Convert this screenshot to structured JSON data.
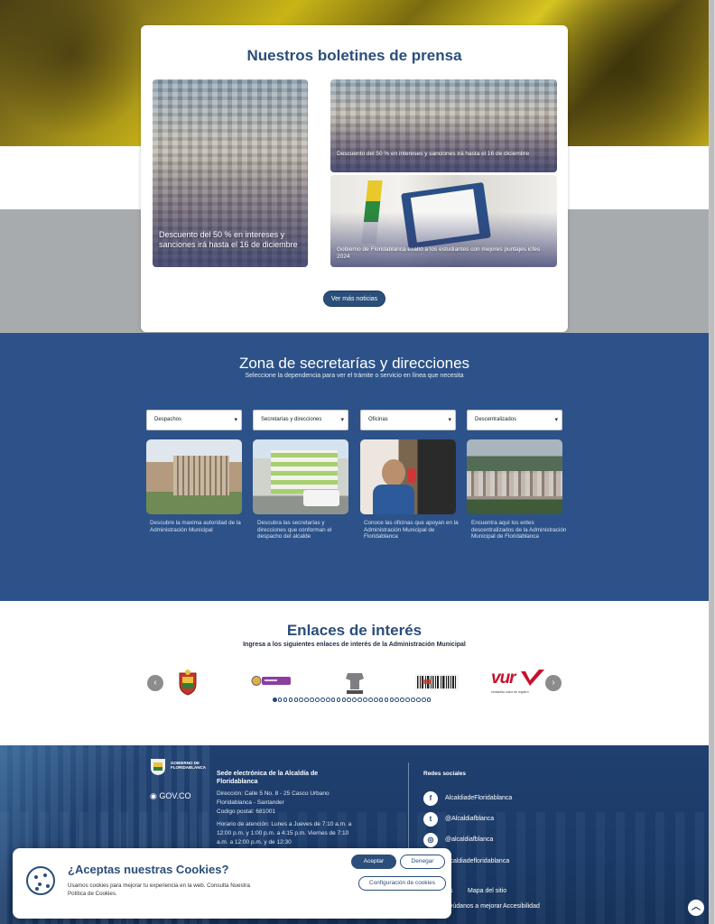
{
  "news": {
    "title": "Nuestros boletines de prensa",
    "items": [
      {
        "caption": "Descuento del 50 % en intereses y sanciones irá hasta el 16 de diciembre"
      },
      {
        "caption": "Descuento del 50 % en intereses y sanciones irá hasta el 16 de diciembre"
      },
      {
        "caption": "Gobierno de Floridablanca exaltó a los estudiantes con mejores puntajes icfes 2024"
      }
    ],
    "more_button": "Ver más noticias"
  },
  "secretarias": {
    "title": "Zona de secretarías y direcciones",
    "subtitle": "Seleccione la dependencia para ver el trámite o servicio en línea que necesita",
    "selects": [
      {
        "value": "Despachos"
      },
      {
        "value": "Secretarías y direcciones"
      },
      {
        "value": "Oficinas"
      },
      {
        "value": "Descentralizados"
      }
    ],
    "cards": [
      {
        "caption": "Descubre la maxima autoridad de la Administración Municipal"
      },
      {
        "caption": "Descubra las secretarías y direcciones que conforman el despacho del alcalde"
      },
      {
        "caption": "Conoce las oficinas que apoyan en la Administración Municipal de Floridablanca"
      },
      {
        "caption": "Encuentra aquí los entes descentralizados de la Administración Municipal de Floridablanca"
      }
    ]
  },
  "enlaces": {
    "title": "Enlaces de interés",
    "subtitle": "Ingresa a los siguientes enlaces de interés de la Administración Municipal",
    "prev_icon": "chevron-left-icon",
    "next_icon": "chevron-right-icon",
    "vur_logo": "vur",
    "vur_tagline": "ventanilla única de registro",
    "dots_total": 30,
    "dots_active": 1
  },
  "footer": {
    "logo_text": "GOBIERNO DE FLORIDABLANCA",
    "govco": "GOV.CO",
    "sede_title": "Sede electrónica de la Alcaldía de Floridablanca",
    "address": "Dirección: Calle 5 No. 8 - 25 Casco Urbano Floridablanca - Santander",
    "postal": "Codigo postal: 681001",
    "hours": "Horario de atención: Lunes a Jueves de 7:10 a.m. a 12:00 p.m. y 1:00 p.m. a 4:15 p.m. Viernes de 7:10 a.m. a 12:00 p.m. y de 12:30",
    "social_title": "Redes sociales",
    "social": [
      {
        "icon": "facebook-icon",
        "glyph": "f",
        "label": "AlcaldiadeFloridablanca"
      },
      {
        "icon": "twitter-icon",
        "glyph": "t",
        "label": "@Alcaldiafblanca"
      },
      {
        "icon": "instagram-icon",
        "glyph": "◎",
        "label": "@alcaldiafblanca"
      },
      {
        "icon": "youtube-icon",
        "glyph": "▶",
        "label": "alcaldiadefloridablanca"
      }
    ],
    "links": [
      "s",
      "Mapa del sitio",
      "ayúdanos a mejorar",
      "Accesibilidad"
    ]
  },
  "cookies": {
    "title": "¿Aceptas nuestras Cookies?",
    "text": "Usamos cookies para mejorar tu experiencia en la web. Consulta Nuestra Política de Cookies.",
    "accept": "Aceptar",
    "deny": "Denegar",
    "config": "Configuración de cookies"
  },
  "colors": {
    "brand_blue": "#2c5289",
    "title_blue": "#2b4e7a",
    "hero_yellow": "#c9b417"
  }
}
